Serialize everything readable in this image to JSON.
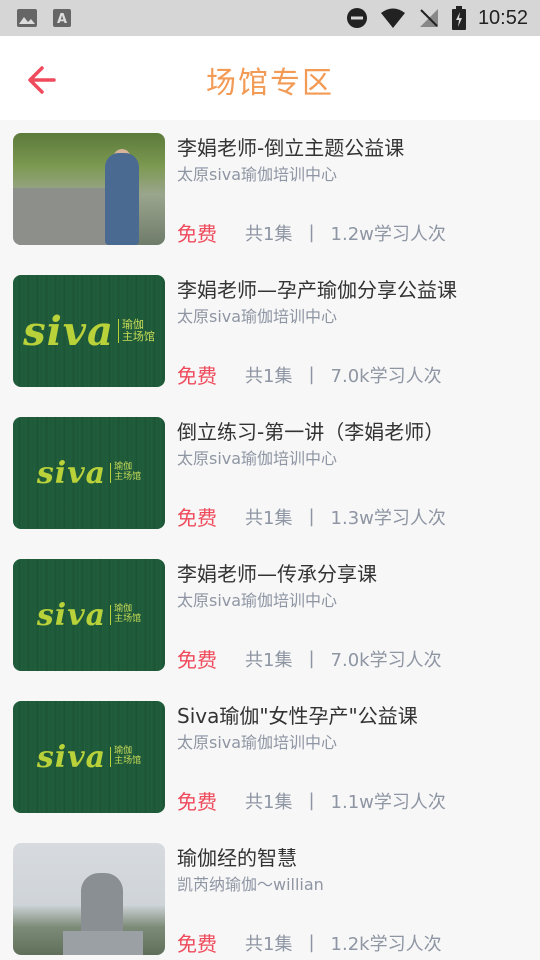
{
  "status_bar": {
    "time": "10:52"
  },
  "header": {
    "title": "场馆专区"
  },
  "courses": [
    {
      "title": "李娟老师-倒立主题公益课",
      "org": "太原siva瑜伽培训中心",
      "price": "免费",
      "episodes": "共1集",
      "learners": "1.2w学习人次",
      "thumb": "photo-person"
    },
    {
      "title": "李娟老师—孕产瑜伽分享公益课",
      "org": "太原siva瑜伽培训中心",
      "price": "免费",
      "episodes": "共1集",
      "learners": "7.0k学习人次",
      "thumb": "siva-logo-large"
    },
    {
      "title": "倒立练习-第一讲（李娟老师）",
      "org": "太原siva瑜伽培训中心",
      "price": "免费",
      "episodes": "共1集",
      "learners": "1.3w学习人次",
      "thumb": "siva-logo"
    },
    {
      "title": "李娟老师—传承分享课",
      "org": "太原siva瑜伽培训中心",
      "price": "免费",
      "episodes": "共1集",
      "learners": "7.0k学习人次",
      "thumb": "siva-logo"
    },
    {
      "title": "Siva瑜伽\"女性孕产\"公益课",
      "org": "太原siva瑜伽培训中心",
      "price": "免费",
      "episodes": "共1集",
      "learners": "1.1w学习人次",
      "thumb": "siva-logo"
    },
    {
      "title": "瑜伽经的智慧",
      "org": "凯芮纳瑜伽～willian",
      "price": "免费",
      "episodes": "共1集",
      "learners": "1.2k学习人次",
      "thumb": "photo-statue"
    }
  ],
  "logo": {
    "brand": "siva",
    "cn_top": "瑜伽",
    "cn_bottom": "主场馆"
  },
  "separator": "|",
  "colors": {
    "title": "#f39a55",
    "back_arrow": "#ef4b5c",
    "free": "#ef4b5c",
    "meta": "#8e95a3"
  }
}
